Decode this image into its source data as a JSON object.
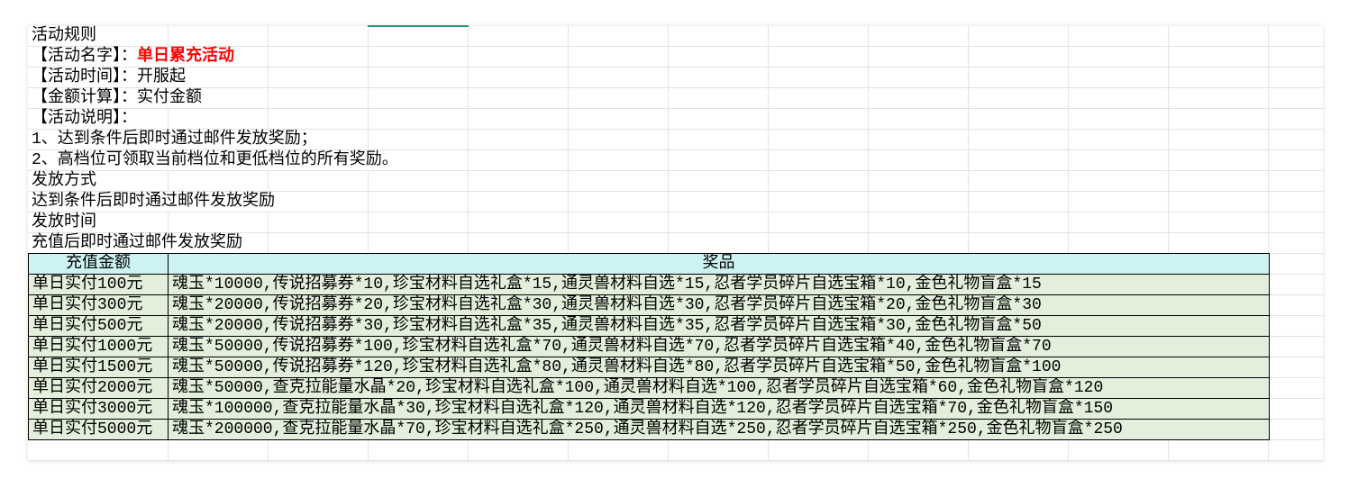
{
  "colors": {
    "gridline": "#e2e2e2",
    "selected_column_indicator": "#1f9e6e",
    "highlight_text": "#ff0000",
    "table_header_bg": "#ccf2f2",
    "table_row_bg": "#e2efda",
    "table_border": "#000000"
  },
  "rules": {
    "title": "活动规则",
    "name_label": "【活动名字】：",
    "name_value": "单日累充活动",
    "time_label": "【活动时间】：",
    "time_value": "开服起",
    "amount_calc_label": "【金额计算】：",
    "amount_calc_value": "实付金额",
    "description_label": "【活动说明】：",
    "description_lines": [
      "1、达到条件后即时通过邮件发放奖励；",
      "2、高档位可领取当前档位和更低档位的所有奖励。"
    ],
    "delivery_method_heading": "发放方式",
    "delivery_method_text": "达到条件后即时通过邮件发放奖励",
    "delivery_time_heading": "发放时间",
    "delivery_time_text": "充值后即时通过邮件发放奖励"
  },
  "rewards_table": {
    "headers": {
      "amount": "充值金额",
      "prizes": "奖品"
    },
    "rows": [
      {
        "amount": "单日实付100元",
        "prizes": "魂玉*10000,传说招募券*10,珍宝材料自选礼盒*15,通灵兽材料自选*15,忍者学员碎片自选宝箱*10,金色礼物盲盒*15"
      },
      {
        "amount": "单日实付300元",
        "prizes": "魂玉*20000,传说招募券*20,珍宝材料自选礼盒*30,通灵兽材料自选*30,忍者学员碎片自选宝箱*20,金色礼物盲盒*30"
      },
      {
        "amount": "单日实付500元",
        "prizes": "魂玉*20000,传说招募券*30,珍宝材料自选礼盒*35,通灵兽材料自选*35,忍者学员碎片自选宝箱*30,金色礼物盲盒*50"
      },
      {
        "amount": "单日实付1000元",
        "prizes": "魂玉*50000,传说招募券*100,珍宝材料自选礼盒*70,通灵兽材料自选*70,忍者学员碎片自选宝箱*40,金色礼物盲盒*70"
      },
      {
        "amount": "单日实付1500元",
        "prizes": "魂玉*50000,传说招募券*120,珍宝材料自选礼盒*80,通灵兽材料自选*80,忍者学员碎片自选宝箱*50,金色礼物盲盒*100"
      },
      {
        "amount": "单日实付2000元",
        "prizes": "魂玉*50000,查克拉能量水晶*20,珍宝材料自选礼盒*100,通灵兽材料自选*100,忍者学员碎片自选宝箱*60,金色礼物盲盒*120"
      },
      {
        "amount": "单日实付3000元",
        "prizes": "魂玉*100000,查克拉能量水晶*30,珍宝材料自选礼盒*120,通灵兽材料自选*120,忍者学员碎片自选宝箱*70,金色礼物盲盒*150"
      },
      {
        "amount": "单日实付5000元",
        "prizes": "魂玉*200000,查克拉能量水晶*70,珍宝材料自选礼盒*250,通灵兽材料自选*250,忍者学员碎片自选宝箱*250,金色礼物盲盒*250"
      }
    ]
  }
}
